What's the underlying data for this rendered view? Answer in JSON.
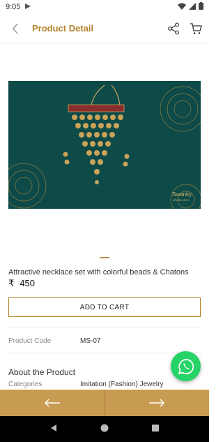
{
  "status_bar": {
    "time": "9:05"
  },
  "header": {
    "title": "Product Detail"
  },
  "product": {
    "name": "Attractive necklace set with colorful beads & Chatons",
    "currency": "₹",
    "price": "450",
    "brand_mark": "Swanky",
    "brand_sub": "JEWELLERY"
  },
  "buttons": {
    "add_to_cart": "ADD TO CART"
  },
  "details": {
    "product_code_label": "Product Code",
    "product_code_value": "MS-07",
    "about_title": "About the Product",
    "categories_label": "Categories",
    "categories_value": "Imitation (Fashion) Jewelry"
  },
  "colors": {
    "accent": "#b5832a",
    "bottom_bar": "#c89b52",
    "whatsapp": "#25d366",
    "image_bg": "#0d4a48"
  }
}
